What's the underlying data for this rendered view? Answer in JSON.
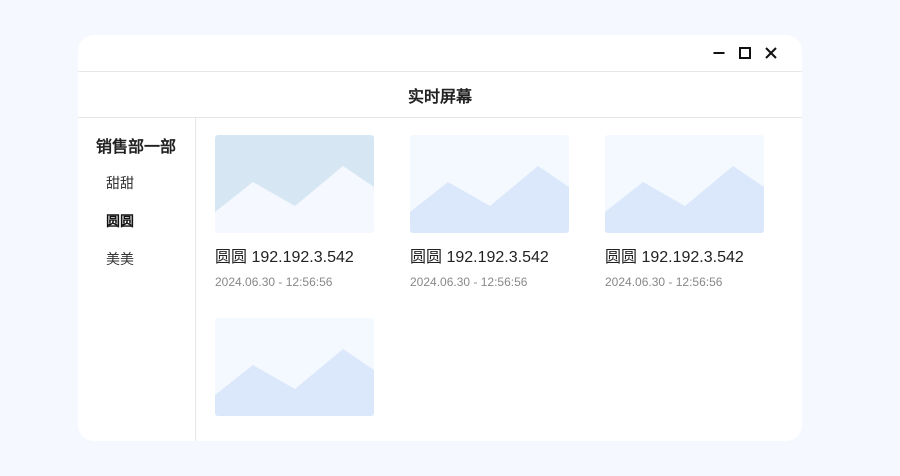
{
  "header": {
    "title": "实时屏幕"
  },
  "sidebar": {
    "group_title": "销售部一部",
    "items": [
      {
        "label": "甜甜"
      },
      {
        "label": "圆圆"
      },
      {
        "label": "美美"
      }
    ],
    "active_item": "圆圆"
  },
  "screens": [
    {
      "title": "圆圆 192.192.3.542",
      "time": "2024.06.30   -   12:56:56",
      "selected": true
    },
    {
      "title": "圆圆 192.192.3.542",
      "time": "2024.06.30   -   12:56:56",
      "selected": false
    },
    {
      "title": "圆圆 192.192.3.542",
      "time": "2024.06.30   -   12:56:56",
      "selected": false
    },
    {
      "title": "",
      "time": "",
      "selected": false
    }
  ],
  "icons": {
    "minimize": "minimize-icon",
    "maximize": "maximize-icon",
    "close": "close-icon",
    "thumbnail": "image-placeholder-icon"
  },
  "colors": {
    "page_bg": "#f5f8fe",
    "thumb_selected_bg": "#d6e7f3",
    "thumb_bg": "#f4f8ff",
    "mountain": "#dbe8fb"
  }
}
